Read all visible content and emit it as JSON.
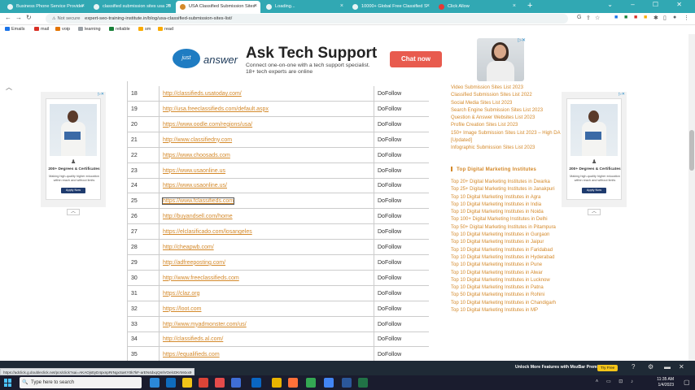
{
  "browser": {
    "tabs": [
      {
        "title": "Business Phone Service Provider",
        "active": false
      },
      {
        "title": "classified submission sites usa 20",
        "active": false
      },
      {
        "title": "USA Classified Submission Sites",
        "active": true
      },
      {
        "title": "Loading...",
        "active": false
      },
      {
        "title": "10000+ Global Free Classified S",
        "active": false
      },
      {
        "title": "Click Allow",
        "active": false
      }
    ],
    "new_tab_label": "+",
    "security_label": "Not secure",
    "url": "expert-seo-training-institute.in/blog/usa-classified-submission-sites-list/",
    "bookmarks": [
      {
        "label": "Emails",
        "color": "#1a73e8"
      },
      {
        "label": "mail",
        "color": "#d93025"
      },
      {
        "label": "voip",
        "color": "#e37400"
      },
      {
        "label": "learning",
        "color": "#9aa0a6"
      },
      {
        "label": "reliable",
        "color": "#188038"
      },
      {
        "label": "sm",
        "color": "#f9ab00"
      },
      {
        "label": "read",
        "color": "#f9ab00"
      }
    ]
  },
  "ad_banner": {
    "logo_text": "just",
    "brand": "answer",
    "title": "Ask Tech Support",
    "subtitle": "Connect one-on-one with a tech support specialist. 18+ tech experts are online",
    "cta": "Chat now"
  },
  "side_ad": {
    "title": "200+ Degrees & Certificates",
    "text": "Making high-quality higher education within reach and without limits",
    "button": "Apply Now"
  },
  "table": {
    "rows": [
      {
        "num": "18",
        "url": "http://classifieds.usatoday.com/",
        "type": "DoFollow"
      },
      {
        "num": "19",
        "url": "http://usa.freeclassifieds.com/default.aspx",
        "type": "DoFollow"
      },
      {
        "num": "20",
        "url": "https://www.oodle.com/regions/usa/",
        "type": "DoFollow"
      },
      {
        "num": "21",
        "url": "http://www.classifiedny.com",
        "type": "DoFollow"
      },
      {
        "num": "22",
        "url": "https://www.choosads.com",
        "type": "DoFollow"
      },
      {
        "num": "23",
        "url": "https://www.usaonline.us",
        "type": "DoFollow"
      },
      {
        "num": "24",
        "url": "https://www.usaonline.us/",
        "type": "DoFollow"
      },
      {
        "num": "25",
        "url": "https://www.fclassifieds.com",
        "type": "DoFollow"
      },
      {
        "num": "26",
        "url": "http://buyandsell.com/home",
        "type": "DoFollow"
      },
      {
        "num": "27",
        "url": "https://elclasificado.com/losangeles",
        "type": "DoFollow"
      },
      {
        "num": "28",
        "url": "http://cheapwb.com/",
        "type": "DoFollow"
      },
      {
        "num": "29",
        "url": "http://adfreeposting.com/",
        "type": "DoFollow"
      },
      {
        "num": "30",
        "url": "http://www.freeclassifieds.com",
        "type": "DoFollow"
      },
      {
        "num": "31",
        "url": "https://claz.org",
        "type": "DoFollow"
      },
      {
        "num": "32",
        "url": "https://loot.com",
        "type": "DoFollow"
      },
      {
        "num": "33",
        "url": "http://www.myadmonster.com/us/",
        "type": "DoFollow"
      },
      {
        "num": "34",
        "url": "http://classifieds.al.com/",
        "type": "DoFollow"
      },
      {
        "num": "35",
        "url": "https://equalifieds.com",
        "type": "DoFollow"
      }
    ]
  },
  "sidebar": {
    "links_top": [
      "Video Submission Sites List 2023",
      "Classified Submission Sites List 2022",
      "Social Media Sites List 2023",
      "Search Engine Submission Sites List 2023",
      "Question & Answer Websites List 2023",
      "Profile Creation Sites List 2023",
      "150+ Image Submission Sites List 2023 – High DA [Updated]",
      "Infographic Submission Sites List 2023"
    ],
    "heading": "Top Digital Marketing Institutes",
    "links_bottom": [
      "Top 20+ Digital Marketing Institutes in Dwarka",
      "Top 25+ Digital Marketing Institutes in Janakpuri",
      "Top 10 Digital Marketing Institutes in Agra",
      "Top 10 Digital Marketing Institutes in India",
      "Top 10 Digital Marketing Institutes in Noida",
      "Top 100+ Digital Marketing Institutes in Delhi",
      "Top 50+ Digital Marketing Institutes in Pitampura",
      "Top 10 Digital Marketing Institutes in Gurgaon",
      "Top 10 Digital Marketing Institutes in Jaipur",
      "Top 10 Digital Marketing Institutes in Faridabad",
      "Top 10 Digital Marketing Institutes in Hyderabad",
      "Top 10 Digital Marketing Institutes in Pune",
      "Top 10 Digital Marketing Institutes in Alwar",
      "Top 10 Digital Marketing Institutes in Lucknow",
      "Top 10 Digital Marketing Institutes in Patna",
      "Top 50 Digital Marketing Institutes in Rohini",
      "Top 10 Digital Marketing Institutes in Chandigarh",
      "Top 10 Digital Marketing Institutes in MP"
    ]
  },
  "status_bar": {
    "hover_url": "https://adclick.g.doubleclick.net/pcs/click?xai=AKAOjsttyD4pxnpRrNgxSaKY0k7kF-arEN4dxqQmlVOelcDKrM4xx9",
    "promo_text": "Unlock More Features with MozBar Premium",
    "promo_button": "Try Free"
  },
  "taskbar": {
    "search_placeholder": "Type here to search",
    "time": "11:35 AM",
    "date": "1/4/2023"
  }
}
